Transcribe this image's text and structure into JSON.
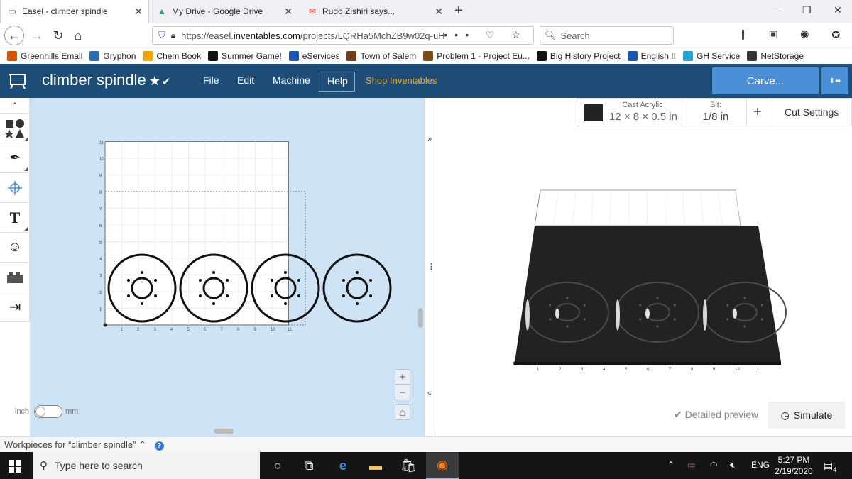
{
  "browser": {
    "tabs": [
      {
        "title": "Easel - climber spindle",
        "active": true
      },
      {
        "title": "My Drive - Google Drive",
        "active": false
      },
      {
        "title": "Rudo Zishiri says...",
        "active": false
      }
    ],
    "url_prefix": "https://easel.",
    "url_domain": "inventables.com",
    "url_rest": "/projects/LQRHa5MchZB9w02q-uH",
    "url_icons": "••• ♡ ☆",
    "search_placeholder": "Search",
    "toolbar_icons": "⫼ ▣ ◉ ✪"
  },
  "bookmarks": [
    {
      "label": "Greenhills Email",
      "icon": "fox-icon",
      "color": "#d35400"
    },
    {
      "label": "Gryphon",
      "icon": "info-icon",
      "color": "#2b6cb0"
    },
    {
      "label": "Chem Book",
      "icon": "circle-icon",
      "color": "#f0a500"
    },
    {
      "label": "Summer Game!",
      "icon": "game-icon",
      "color": "#111111"
    },
    {
      "label": "eServices",
      "icon": "e-icon",
      "color": "#1a56b0"
    },
    {
      "label": "Town of Salem",
      "icon": "salem-icon",
      "color": "#6b3e1e"
    },
    {
      "label": "Problem 1 - Project Eu...",
      "icon": "doc-icon",
      "color": "#7a4b16"
    },
    {
      "label": "Big History Project",
      "icon": "bhp-icon",
      "color": "#111111"
    },
    {
      "label": "English II",
      "icon": "table-icon",
      "color": "#1a56b0"
    },
    {
      "label": "GH Service",
      "icon": "ghs-icon",
      "color": "#2aa4d5"
    },
    {
      "label": "NetStorage",
      "icon": "globe-icon",
      "color": "#333333"
    }
  ],
  "app": {
    "project_title": "climber spindle",
    "menu": [
      "File",
      "Edit",
      "Machine",
      "Help"
    ],
    "shop": "Shop Inventables",
    "carve": "Carve...",
    "brand_color": "#1e4d78",
    "accent_color": "#4b8fd6"
  },
  "canvas": {
    "y_ticks": [
      "11",
      "10",
      "9",
      "8",
      "7",
      "6",
      "5",
      "4",
      "3",
      "2",
      "1"
    ],
    "x_ticks": [
      "1",
      "2",
      "3",
      "4",
      "5",
      "6",
      "7",
      "8",
      "9",
      "10",
      "11"
    ],
    "unit_inch": "inch",
    "unit_mm": "mm",
    "zoom_in": "+",
    "zoom_out": "−",
    "home": "⌂",
    "wheel_count": 4
  },
  "divider": {
    "expand_right": "»",
    "menu": "⋮",
    "collapse": "«"
  },
  "preview": {
    "material_name": "Cast Acrylic",
    "material_size": "12 × 8 × 0.5 in",
    "bit_label": "Bit:",
    "bit_value": "1/8 in",
    "add": "+",
    "cut_settings": "Cut Settings",
    "detailed_preview": "Detailed preview",
    "simulate": "Simulate",
    "x_ticks": [
      "1",
      "2",
      "3",
      "4",
      "5",
      "6",
      "7",
      "8",
      "9",
      "10",
      "11"
    ],
    "material_color": "#222222"
  },
  "workpieces": {
    "label": "Workpieces for “climber spindle” ⌃"
  },
  "taskbar": {
    "search_placeholder": "Type here to search",
    "lang": "ENG",
    "time": "5:27 PM",
    "date": "2/19/2020",
    "notifications": "4"
  }
}
